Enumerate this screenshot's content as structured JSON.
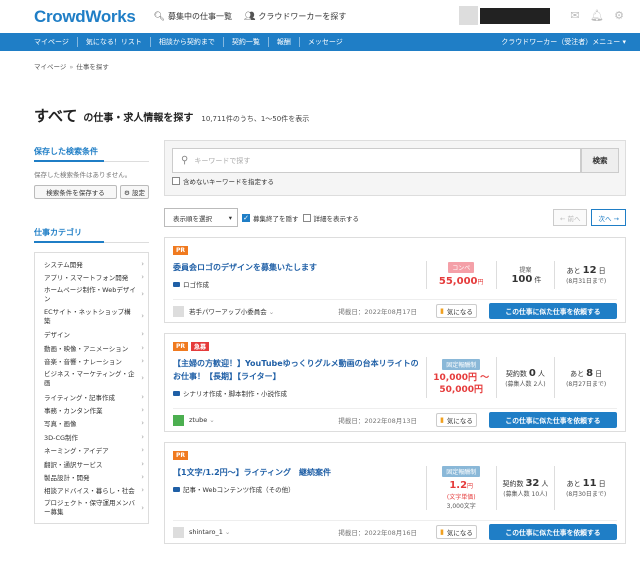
{
  "header": {
    "logo": "CrowdWorks",
    "links": [
      "募集中の仕事一覧",
      "クラウドワーカーを探す"
    ]
  },
  "nav": {
    "items": [
      "マイページ",
      "気になる！リスト",
      "相談から契約まで",
      "契約一覧",
      "報酬",
      "メッセージ"
    ],
    "right": "クラウドワーカー（受注者）メニュー ▾"
  },
  "breadcrumb": [
    "マイページ",
    "仕事を探す"
  ],
  "title": {
    "big": "すべて",
    "mid": "の仕事・求人情報を探す",
    "small": "10,711件のうち、1〜50件を表示"
  },
  "sidebar": {
    "saved_heading": "保存した検索条件",
    "saved_note": "保存した検索条件はありません。",
    "save_button": "検索条件を保存する",
    "settings_button": "⚙ 設定",
    "category_heading": "仕事カテゴリ",
    "categories": [
      "システム開発",
      "アプリ・スマートフォン開発",
      "ホームページ制作・Webデザイン",
      "ECサイト・ネットショップ構築",
      "デザイン",
      "動画・映像・アニメーション",
      "音楽・音響・ナレーション",
      "ビジネス・マーケティング・企画",
      "ライティング・記事作成",
      "事務・カンタン作業",
      "写真・画像",
      "3D-CG制作",
      "ネーミング・アイデア",
      "翻訳・通訳サービス",
      "製品設計・開発",
      "相談アドバイス・暮らし・社会",
      "プロジェクト・保守運用メンバー募集"
    ]
  },
  "search": {
    "placeholder": "キーワードで探す",
    "button": "検索",
    "exclude_label": "含めないキーワードを指定する"
  },
  "controls": {
    "sort": "表示順を選択",
    "hide_closed": "募集終了を隠す",
    "show_detail": "詳細を表示する",
    "prev": "← 前へ",
    "next": "次へ →"
  },
  "jobs": [
    {
      "tags": [
        "PR"
      ],
      "title": "委員会ロゴのデザインを募集いたします",
      "category": "ロゴ作成",
      "type": "コンペ",
      "price": "55,000",
      "price_unit": "円",
      "stat_label": "提案",
      "stat_value": "100",
      "stat_unit": "件",
      "stat_sub": "",
      "remain_label": "あと",
      "remain_value": "12",
      "remain_unit": "日",
      "deadline": "(8月31日まで)",
      "owner": "若手パワーアップ小委員会",
      "posted": "掲載日：2022年08月17日"
    },
    {
      "tags": [
        "PR",
        "急募"
      ],
      "title": "【主婦の方歓迎！】YouTubeゆっくりグルメ動画の台本リライトのお仕事！【長期】【ライター】",
      "category": "シナリオ作成・脚本制作・小説作成",
      "type": "固定報酬制",
      "price": "10,000円 〜",
      "price2": "50,000円",
      "stat_label": "契約数",
      "stat_value": "0",
      "stat_unit": "人",
      "stat_sub": "(募集人数 2人)",
      "remain_label": "あと",
      "remain_value": "8",
      "remain_unit": "日",
      "deadline": "(8月27日まで)",
      "owner": "ztube",
      "posted": "掲載日：2022年08月13日"
    },
    {
      "tags": [
        "PR"
      ],
      "title": "【1文字/1.2円〜】ライティング　継続案件",
      "category": "記事・Webコンテンツ作成（その他）",
      "type": "固定報酬制",
      "price": "1.2",
      "price_unit": "円",
      "price_note": "(文字単価)",
      "price_sub": "3,000文字",
      "stat_label": "契約数",
      "stat_value": "32",
      "stat_unit": "人",
      "stat_sub": "(募集人数 10人)",
      "remain_label": "あと",
      "remain_value": "11",
      "remain_unit": "日",
      "deadline": "(8月30日まで)",
      "owner": "shintaro_1",
      "posted": "掲載日：2022年08月16日"
    }
  ],
  "card_buttons": {
    "like": "気になる",
    "apply": "この仕事に似た仕事を依頼する"
  }
}
